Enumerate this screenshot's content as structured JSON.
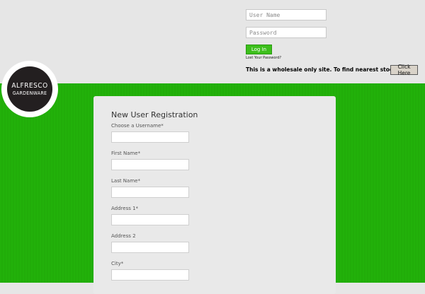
{
  "header": {
    "logo": {
      "line1": "ALFRESCO",
      "line2": "GARDENWARE"
    },
    "login": {
      "username_placeholder": "User Name",
      "password_placeholder": "Password",
      "login_label": "Log In",
      "lost_password": "Lost Your Password?"
    },
    "notice": {
      "text": "This is a wholesale only site. To find nearest stockist",
      "button_label": "Click Here"
    }
  },
  "registration": {
    "title": "New User Registration",
    "fields": [
      {
        "label": "Choose a Username*"
      },
      {
        "label": "First Name*"
      },
      {
        "label": "Last Name*"
      },
      {
        "label": "Address 1*"
      },
      {
        "label": "Address 2"
      },
      {
        "label": "City*"
      }
    ]
  },
  "colors": {
    "background": "#e6e6e6",
    "green": "#22b10a",
    "login_button": "#3dbf1c",
    "logo_dark": "#231f20"
  }
}
